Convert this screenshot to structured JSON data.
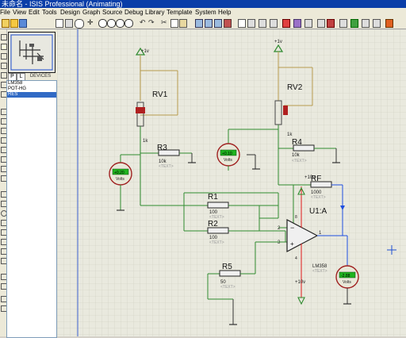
{
  "window": {
    "title": "未命名 - ISIS Professional (Animating)"
  },
  "menu": [
    "File",
    "View",
    "Edit",
    "Tools",
    "Design",
    "Graph",
    "Source",
    "Debug",
    "Library",
    "Template",
    "System",
    "Help"
  ],
  "panel": {
    "p_button": "P",
    "l_button": "L",
    "devices_label": "DEVICES",
    "devices": [
      "LM358",
      "POT-HG",
      "RES"
    ],
    "selected_device": "RES"
  },
  "schematic": {
    "supply_pos": "+1v",
    "supply_pos_right": "+1v",
    "rv1": "RV1",
    "rv1_value": "1k",
    "rv2": "RV2",
    "rv2_value": "1k",
    "r3": "R3",
    "r3_value": "10k",
    "r3_text": "<TEXT>",
    "r4": "R4",
    "r4_value": "10k",
    "r4_text": "<TEXT>",
    "r1": "R1",
    "r1_value": "100",
    "r1_text": "<TEXT>",
    "r2": "R2",
    "r2_value": "100",
    "r2_text": "<TEXT>",
    "r5": "R5",
    "r5_value": "50",
    "r5_text": "<TEXT>",
    "rf": "RF",
    "rf_value": "1000",
    "rf_text": "<TEXT>",
    "opamp": "U1:A",
    "opamp_part": "LM358",
    "opamp_text": "<TEXT>",
    "opamp_vcc": "+10v",
    "opamp_vee": "+10v",
    "pin2": "2",
    "pin3": "3",
    "pin1": "1",
    "pin8": "8",
    "pin4": "4",
    "volt1_reading": "+0.20",
    "volt2_reading": "+0.10",
    "volt3_reading": "-2.88",
    "volts_unit": "Volts",
    "colors": {
      "wire_green": "#2f8a2f",
      "wire_tan": "#b89a4e",
      "wire_blue": "#1f4fe0",
      "wire_red": "#e01818",
      "meter_lcd": "#1fb41f"
    }
  }
}
